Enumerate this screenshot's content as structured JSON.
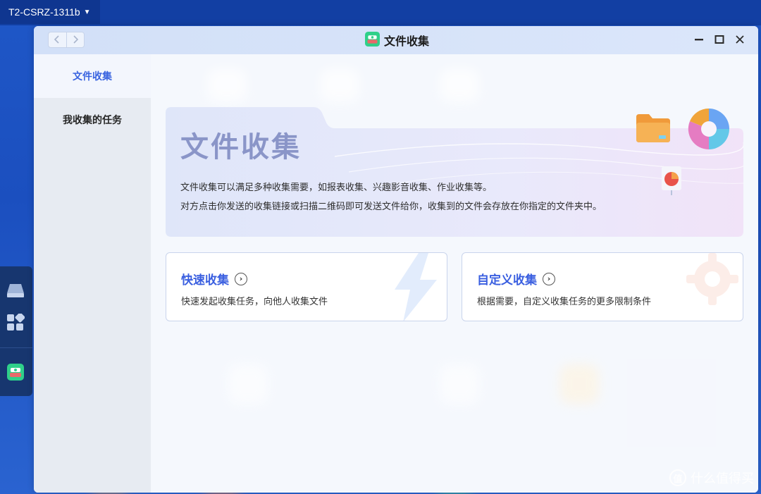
{
  "desktop": {
    "device_name": "T2-CSRZ-1311b",
    "dock_icons": [
      "drive-icon",
      "apps-grid-icon",
      "file-collect-app-icon"
    ]
  },
  "window": {
    "title": "文件收集",
    "app_icon": "file-collect-app-icon",
    "nav": {
      "back_icon": "chevron-left-icon",
      "forward_icon": "chevron-right-icon"
    },
    "controls": [
      "minimize-icon",
      "maximize-icon",
      "close-icon"
    ]
  },
  "sidebar": {
    "items": [
      {
        "label": "文件收集",
        "active": true
      },
      {
        "label": "我收集的任务",
        "active": false
      }
    ]
  },
  "hero": {
    "title": "文件收集",
    "desc_line1": "文件收集可以满足多种收集需要，如报表收集、兴趣影音收集、作业收集等。",
    "desc_line2": "对方点击你发送的收集链接或扫描二维码即可发送文件给你，收集到的文件会存放在你指定的文件夹中。",
    "illustration_icons": [
      "folder-icon",
      "pie-chart-icon",
      "report-icon"
    ]
  },
  "cards": [
    {
      "title": "快速收集",
      "desc": "快速发起收集任务，向他人收集文件",
      "deco_icon": "lightning-icon"
    },
    {
      "title": "自定义收集",
      "desc": "根据需要，自定义收集任务的更多限制条件",
      "deco_icon": "gear-icon"
    }
  ],
  "watermark": {
    "text": "什么值得买",
    "icon_text": "值"
  },
  "colors": {
    "accent": "#3a64e0",
    "desktop": "#1f57c7"
  }
}
